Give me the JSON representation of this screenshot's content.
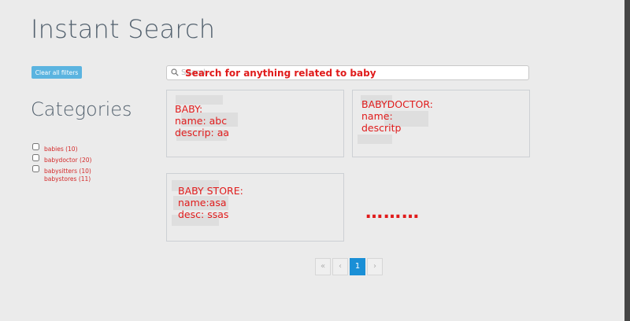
{
  "header": {
    "title": "Instant Search"
  },
  "filters": {
    "clear_label": "Clear all filters"
  },
  "categories": {
    "title": "Categories",
    "items": [
      {
        "label": "babies (10)"
      },
      {
        "label": "babydoctor (20)"
      },
      {
        "label": "babysitters (10)"
      }
    ],
    "extra_label": "babystores (11)"
  },
  "search": {
    "placeholder": "Search",
    "annotation": "Search for anything related to baby"
  },
  "results": [
    {
      "text": "BABY:\nname: abc\ndescrip: aa"
    },
    {
      "text": "BABYDOCTOR:\nname:\ndescritp"
    },
    {
      "text": "BABY STORE:\nname:asa\ndesc: ssas"
    }
  ],
  "more_indicator": "………",
  "pagination": {
    "first": "«",
    "prev": "‹",
    "current": "1",
    "next": "›"
  },
  "colors": {
    "annotation": "#e01b1b",
    "accent": "#1a8fd6",
    "button": "#5bb4e0"
  }
}
